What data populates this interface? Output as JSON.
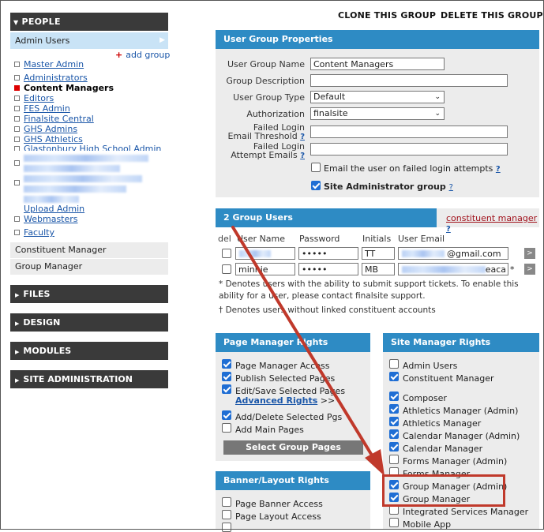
{
  "sidebar": {
    "people_header": "PEOPLE",
    "admin_users": "Admin Users",
    "add_group": "add group",
    "groups": [
      {
        "label": "Master Admin",
        "active": false
      },
      {
        "label": "Administrators",
        "active": false
      },
      {
        "label": "Content Managers",
        "active": true
      },
      {
        "label": "Editors",
        "active": false
      },
      {
        "label": "FES Admin",
        "active": false
      },
      {
        "label": "Finalsite Central",
        "active": false
      },
      {
        "label": "GHS Admins",
        "active": false
      },
      {
        "label": "GHS Athletics",
        "active": false
      },
      {
        "label": "Glastonbury High School Admin",
        "active": false
      },
      {
        "label": "Upload Admin",
        "active": false
      },
      {
        "label": "Webmasters",
        "active": false
      },
      {
        "label": "Faculty",
        "active": false
      }
    ],
    "constituent_manager": "Constituent Manager",
    "group_manager": "Group Manager",
    "sections": [
      "FILES",
      "DESIGN",
      "MODULES",
      "SITE ADMINISTRATION"
    ]
  },
  "top_actions": {
    "clone": "CLONE THIS GROUP",
    "delete": "DELETE THIS GROUP"
  },
  "properties": {
    "header": "User Group Properties",
    "name_label": "User Group Name",
    "name_value": "Content Managers",
    "desc_label": "Group Description",
    "type_label": "User Group Type",
    "type_value": "Default",
    "auth_label": "Authorization",
    "auth_value": "finalsite",
    "failed_email_label_1": "Failed Login",
    "failed_email_label_2": "Email Threshold",
    "failed_attempt_label_1": "Failed Login",
    "failed_attempt_label_2": "Attempt Emails",
    "email_user_label": "Email the user on failed login attempts",
    "site_admin_label": "Site Administrator group",
    "q": "?"
  },
  "group_users": {
    "header": "2 Group Users",
    "constituent_link": "constituent manager",
    "columns": {
      "del": "del",
      "username": "User Name",
      "password": "Password",
      "initials": "Initials",
      "email": "User Email"
    },
    "rows": [
      {
        "username": "",
        "password": "•••••",
        "initials": "TT",
        "email": "@gmail.com",
        "mark": ""
      },
      {
        "username": "minnie",
        "password": "•••••",
        "initials": "MB",
        "email": "eaca",
        "mark": "*"
      }
    ],
    "note1": "* Denotes users with the ability to submit support tickets. To enable this ability for a user, please contact finalsite support.",
    "note2": "† Denotes users without linked constituent accounts"
  },
  "page_manager": {
    "header": "Page Manager Rights",
    "items": [
      {
        "label": "Page Manager Access",
        "checked": true
      },
      {
        "label": "Publish Selected Pages",
        "checked": true
      },
      {
        "label": "Edit/Save Selected Pages",
        "checked": true
      },
      {
        "label": "Add/Delete Selected Pgs",
        "checked": true
      },
      {
        "label": "Add Main Pages",
        "checked": false
      }
    ],
    "advanced_rights": "Advanced Rights",
    "advanced_suffix": ">>",
    "select_button": "Select Group Pages"
  },
  "banner_layout": {
    "header": "Banner/Layout Rights",
    "items": [
      {
        "label": "Page Banner Access",
        "checked": false
      },
      {
        "label": "Page Layout Access",
        "checked": false
      }
    ]
  },
  "site_manager": {
    "header": "Site Manager Rights",
    "items": [
      {
        "label": "Admin Users",
        "checked": false
      },
      {
        "label": "Constituent Manager",
        "checked": true
      },
      {
        "label": "Composer",
        "checked": true
      },
      {
        "label": "Athletics Manager (Admin)",
        "checked": true
      },
      {
        "label": "Athletics Manager",
        "checked": true
      },
      {
        "label": "Calendar Manager (Admin)",
        "checked": true
      },
      {
        "label": "Calendar Manager",
        "checked": true
      },
      {
        "label": "Forms Manager (Admin)",
        "checked": false
      },
      {
        "label": "Forms Manager",
        "checked": false
      },
      {
        "label": "Group Manager (Admin)",
        "checked": true
      },
      {
        "label": "Group Manager",
        "checked": true
      },
      {
        "label": "Integrated Services Manager",
        "checked": false
      },
      {
        "label": "Mobile App",
        "checked": false
      }
    ]
  },
  "colors": {
    "panel_blue": "#2e8bc4",
    "annotation_red": "#c0392b",
    "checkbox_blue": "#1f6ed4"
  }
}
